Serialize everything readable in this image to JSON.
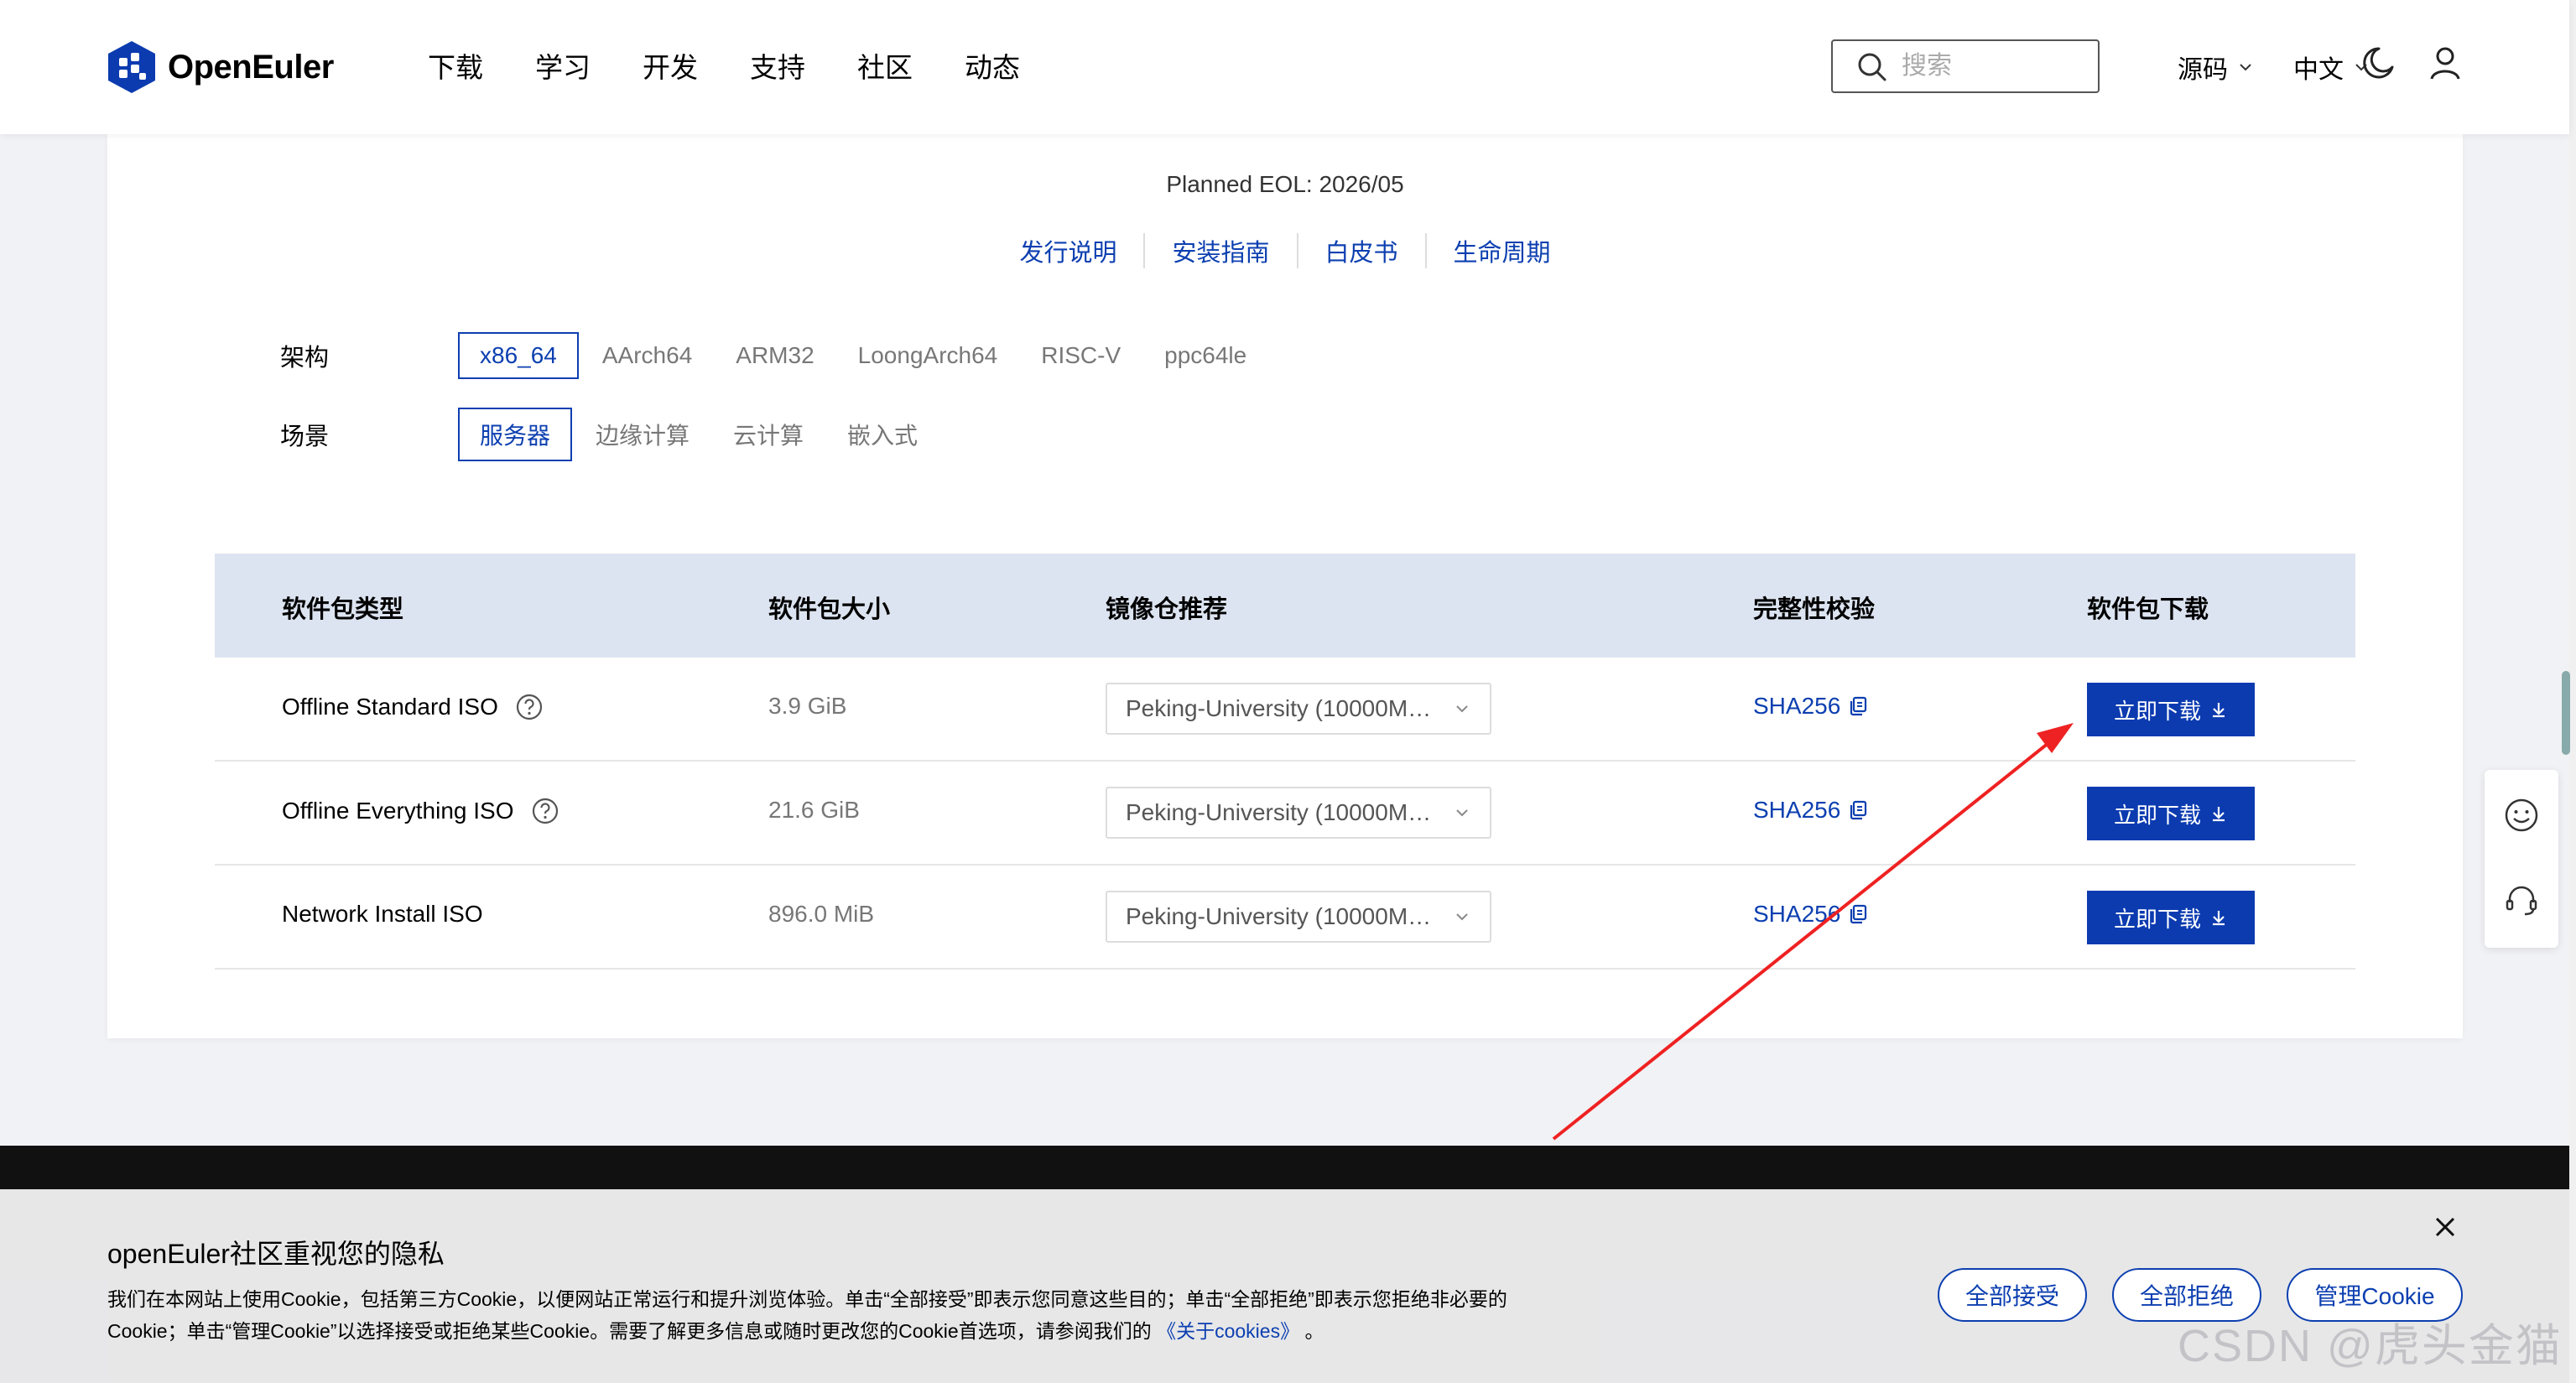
{
  "header": {
    "logo_text": "OpenEuler",
    "nav": [
      "下载",
      "学习",
      "开发",
      "支持",
      "社区",
      "动态"
    ],
    "search_placeholder": "搜索",
    "source_label": "源码",
    "lang_label": "中文"
  },
  "release": {
    "eol": "Planned EOL: 2026/05",
    "links": [
      "发行说明",
      "安装指南",
      "白皮书",
      "生命周期"
    ]
  },
  "filters": {
    "arch_label": "架构",
    "arch_options": [
      "x86_64",
      "AArch64",
      "ARM32",
      "LoongArch64",
      "RISC-V",
      "ppc64le"
    ],
    "arch_selected": "x86_64",
    "scene_label": "场景",
    "scene_options": [
      "服务器",
      "边缘计算",
      "云计算",
      "嵌入式"
    ],
    "scene_selected": "服务器"
  },
  "table": {
    "headers": [
      "软件包类型",
      "软件包大小",
      "镜像仓推荐",
      "完整性校验",
      "软件包下载"
    ],
    "rows": [
      {
        "type": "Offline Standard ISO",
        "size": "3.9 GiB",
        "mirror": "Peking-University (10000M…",
        "checksum": "SHA256",
        "download": "立即下载"
      },
      {
        "type": "Offline Everything ISO",
        "size": "21.6 GiB",
        "mirror": "Peking-University (10000M…",
        "checksum": "SHA256",
        "download": "立即下载"
      },
      {
        "type": "Network Install ISO",
        "size": "896.0 MiB",
        "mirror": "Peking-University (10000M…",
        "checksum": "SHA256",
        "download": "立即下载"
      }
    ]
  },
  "cookie": {
    "title": "openEuler社区重视您的隐私",
    "text": "我们在本网站上使用Cookie，包括第三方Cookie，以便网站正常运行和提升浏览体验。单击“全部接受”即表示您同意这些目的；单击“全部拒绝”即表示您拒绝非必要的Cookie；单击“管理Cookie”以选择接受或拒绝某些Cookie。需要了解更多信息或随时更改您的Cookie首选项，请参阅我们的",
    "link": "《关于cookies》",
    "tail": "。",
    "accept": "全部接受",
    "reject": "全部拒绝",
    "manage": "管理Cookie"
  },
  "watermark": "CSDN @虎头金猫",
  "colors": {
    "accent": "#0c3fb0",
    "annotation": "#ee2222"
  }
}
